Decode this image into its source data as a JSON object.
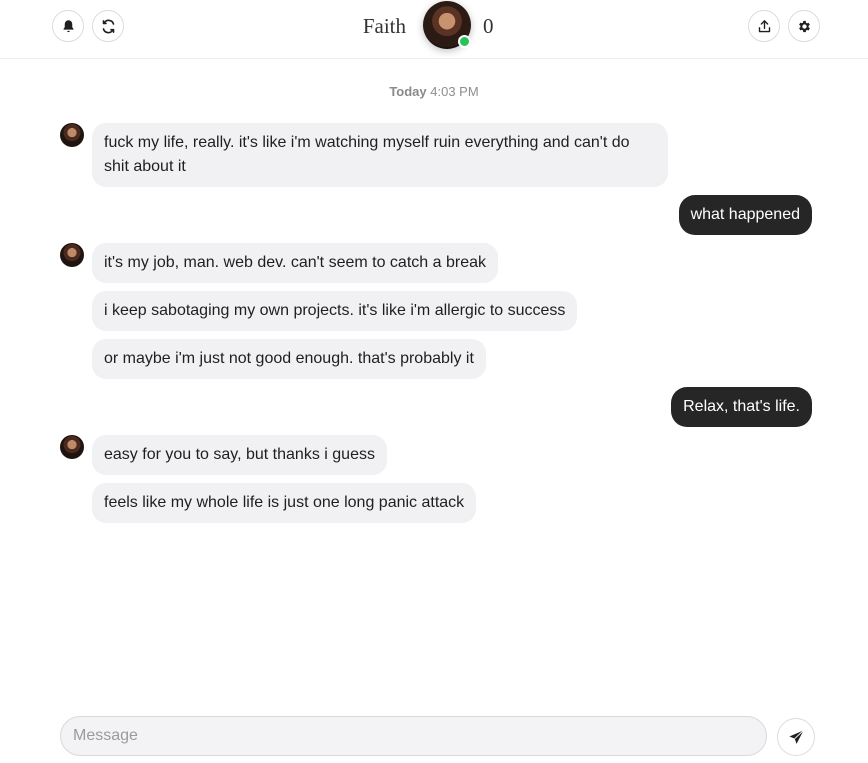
{
  "header": {
    "contact_name": "Faith",
    "counter": "0",
    "online": true,
    "icons": {
      "notifications": "bell-icon",
      "refresh": "refresh-icon",
      "share": "share-icon",
      "settings": "gear-icon"
    }
  },
  "timestamp": {
    "day": "Today",
    "time": "4:03 PM"
  },
  "messages": [
    {
      "from": "contact",
      "text": "fuck my life, really. it's like i'm watching myself ruin everything and can't do shit about it"
    },
    {
      "from": "user",
      "text": "what happened"
    },
    {
      "from": "contact",
      "text": "it's my job, man. web dev. can't seem to catch a break"
    },
    {
      "from": "contact",
      "text": "i keep sabotaging my own projects. it's like i'm allergic to success"
    },
    {
      "from": "contact",
      "text": "or maybe i'm just not good enough. that's probably it"
    },
    {
      "from": "user",
      "text": "Relax, that's life."
    },
    {
      "from": "contact",
      "text": "easy for you to say, but thanks i guess"
    },
    {
      "from": "contact",
      "text": "feels like my whole life is just one long panic attack"
    }
  ],
  "composer": {
    "placeholder": "Message",
    "value": "",
    "send_icon": "send-icon"
  },
  "colors": {
    "outgoing_bubble": "#262626",
    "incoming_bubble": "#f1f1f3",
    "online_indicator": "#25c45a"
  }
}
